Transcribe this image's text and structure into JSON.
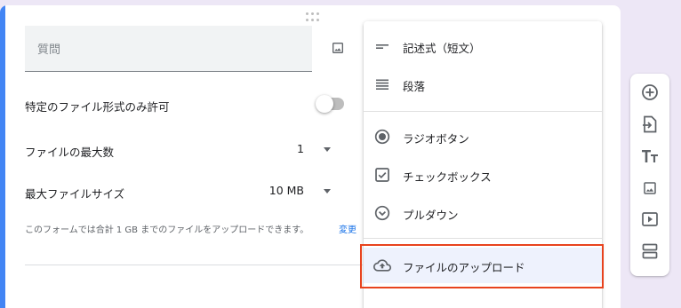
{
  "question": {
    "placeholder": "質問"
  },
  "settings": {
    "specific_file_types_label": "特定のファイル形式のみ許可",
    "max_files_label": "ファイルの最大数",
    "max_files_value": "1",
    "max_size_label": "最大ファイルサイズ",
    "max_size_value": "10 MB",
    "quota_note": "このフォームでは合計 1 GB までのファイルをアップロードできます。",
    "change_link": "変更"
  },
  "menu": {
    "items": [
      {
        "label": "記述式（短文）",
        "icon": "short-answer-icon"
      },
      {
        "label": "段落",
        "icon": "paragraph-icon"
      },
      {
        "label": "ラジオボタン",
        "icon": "radio-button-icon"
      },
      {
        "label": "チェックボックス",
        "icon": "checkbox-icon"
      },
      {
        "label": "プルダウン",
        "icon": "dropdown-icon"
      },
      {
        "label": "ファイルのアップロード",
        "icon": "cloud-upload-icon"
      }
    ],
    "selected_index": 5
  },
  "toolbar": {
    "buttons": [
      "add-question-icon",
      "import-questions-icon",
      "add-title-icon",
      "add-image-icon",
      "add-video-icon",
      "add-section-icon"
    ]
  },
  "colors": {
    "accent": "#4285f4",
    "highlight": "#e8431e",
    "background": "#ede7f6",
    "link": "#1a73e8",
    "selected_item": "#eef2fd"
  }
}
